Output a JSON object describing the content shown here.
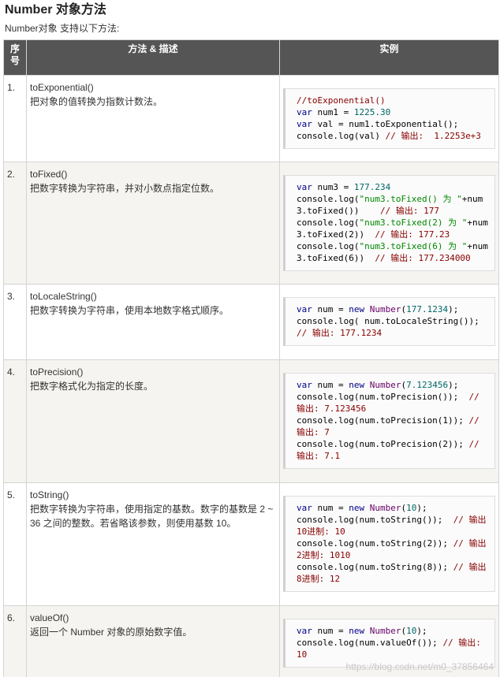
{
  "page": {
    "title": "Number 对象方法",
    "subtitle": "Number对象 支持以下方法:"
  },
  "table": {
    "headers": {
      "num": "序号",
      "desc": "方法 & 描述",
      "example": "实例"
    },
    "rows": [
      {
        "index": "1.",
        "method": "toExponential()",
        "description": "把对象的值转换为指数计数法。",
        "code": [
          [
            {
              "t": "//toExponential()",
              "c": "com"
            }
          ],
          [
            {
              "t": "var",
              "c": "kw"
            },
            {
              "t": " num1 = "
            },
            {
              "t": "1225.30",
              "c": "num"
            }
          ],
          [
            {
              "t": "var",
              "c": "kw"
            },
            {
              "t": " val = num1.toExponential();"
            }
          ],
          [
            {
              "t": "console.log(val) "
            },
            {
              "t": "// 输出:  1.2253e+3",
              "c": "com"
            }
          ]
        ]
      },
      {
        "index": "2.",
        "method": "toFixed()",
        "description": "把数字转换为字符串，并对小数点指定位数。",
        "code": [
          [
            {
              "t": "var",
              "c": "kw"
            },
            {
              "t": " num3 = "
            },
            {
              "t": "177.234",
              "c": "num"
            }
          ],
          [
            {
              "t": "console.log("
            },
            {
              "t": "\"num3.toFixed() 为 \"",
              "c": "str"
            },
            {
              "t": "+num3.toFixed())    "
            },
            {
              "t": "// 输出: 177",
              "c": "com"
            }
          ],
          [
            {
              "t": "console.log("
            },
            {
              "t": "\"num3.toFixed(2) 为 \"",
              "c": "str"
            },
            {
              "t": "+num3.toFixed(2))  "
            },
            {
              "t": "// 输出: 177.23",
              "c": "com"
            }
          ],
          [
            {
              "t": "console.log("
            },
            {
              "t": "\"num3.toFixed(6) 为 \"",
              "c": "str"
            },
            {
              "t": "+num3.toFixed(6))  "
            },
            {
              "t": "// 输出: 177.234000",
              "c": "com"
            }
          ]
        ]
      },
      {
        "index": "3.",
        "method": "toLocaleString()",
        "description": "把数字转换为字符串，使用本地数字格式顺序。",
        "code": [
          [
            {
              "t": "var",
              "c": "kw"
            },
            {
              "t": " num = "
            },
            {
              "t": "new",
              "c": "kw"
            },
            {
              "t": " "
            },
            {
              "t": "Number",
              "c": "fn"
            },
            {
              "t": "("
            },
            {
              "t": "177.1234",
              "c": "num"
            },
            {
              "t": ");"
            }
          ],
          [
            {
              "t": "console.log( num.toLocaleString());"
            }
          ],
          [
            {
              "t": "// 输出: 177.1234",
              "c": "com"
            }
          ]
        ]
      },
      {
        "index": "4.",
        "method": "toPrecision()",
        "description": "把数字格式化为指定的长度。",
        "code": [
          [
            {
              "t": "var",
              "c": "kw"
            },
            {
              "t": " num = "
            },
            {
              "t": "new",
              "c": "kw"
            },
            {
              "t": " "
            },
            {
              "t": "Number",
              "c": "fn"
            },
            {
              "t": "("
            },
            {
              "t": "7.123456",
              "c": "num"
            },
            {
              "t": ");"
            }
          ],
          [
            {
              "t": "console.log(num.toPrecision());  "
            },
            {
              "t": "// 输出: 7.123456",
              "c": "com"
            }
          ],
          [
            {
              "t": "console.log(num.toPrecision(1)); "
            },
            {
              "t": "// 输出: 7",
              "c": "com"
            }
          ],
          [
            {
              "t": "console.log(num.toPrecision(2)); "
            },
            {
              "t": "// 输出: 7.1",
              "c": "com"
            }
          ]
        ]
      },
      {
        "index": "5.",
        "method": "toString()",
        "description": "把数字转换为字符串，使用指定的基数。数字的基数是 2 ~ 36 之间的整数。若省略该参数，则使用基数 10。",
        "code": [
          [
            {
              "t": "var",
              "c": "kw"
            },
            {
              "t": " num = "
            },
            {
              "t": "new",
              "c": "kw"
            },
            {
              "t": " "
            },
            {
              "t": "Number",
              "c": "fn"
            },
            {
              "t": "("
            },
            {
              "t": "10",
              "c": "num"
            },
            {
              "t": ");"
            }
          ],
          [
            {
              "t": "console.log(num.toString());  "
            },
            {
              "t": "// 输出10进制: 10",
              "c": "com"
            }
          ],
          [
            {
              "t": "console.log(num.toString(2)); "
            },
            {
              "t": "// 输出2进制: 1010",
              "c": "com"
            }
          ],
          [
            {
              "t": "console.log(num.toString(8)); "
            },
            {
              "t": "// 输出8进制: 12",
              "c": "com"
            }
          ]
        ]
      },
      {
        "index": "6.",
        "method": "valueOf()",
        "description": "返回一个 Number 对象的原始数字值。",
        "code": [
          [
            {
              "t": "var",
              "c": "kw"
            },
            {
              "t": " num = "
            },
            {
              "t": "new",
              "c": "kw"
            },
            {
              "t": " "
            },
            {
              "t": "Number",
              "c": "fn"
            },
            {
              "t": "("
            },
            {
              "t": "10",
              "c": "num"
            },
            {
              "t": ");"
            }
          ],
          [
            {
              "t": "console.log(num.valueOf()); "
            },
            {
              "t": "// 输出: 10",
              "c": "com"
            }
          ]
        ]
      }
    ]
  },
  "watermark": "https://blog.csdn.net/m0_37856464"
}
